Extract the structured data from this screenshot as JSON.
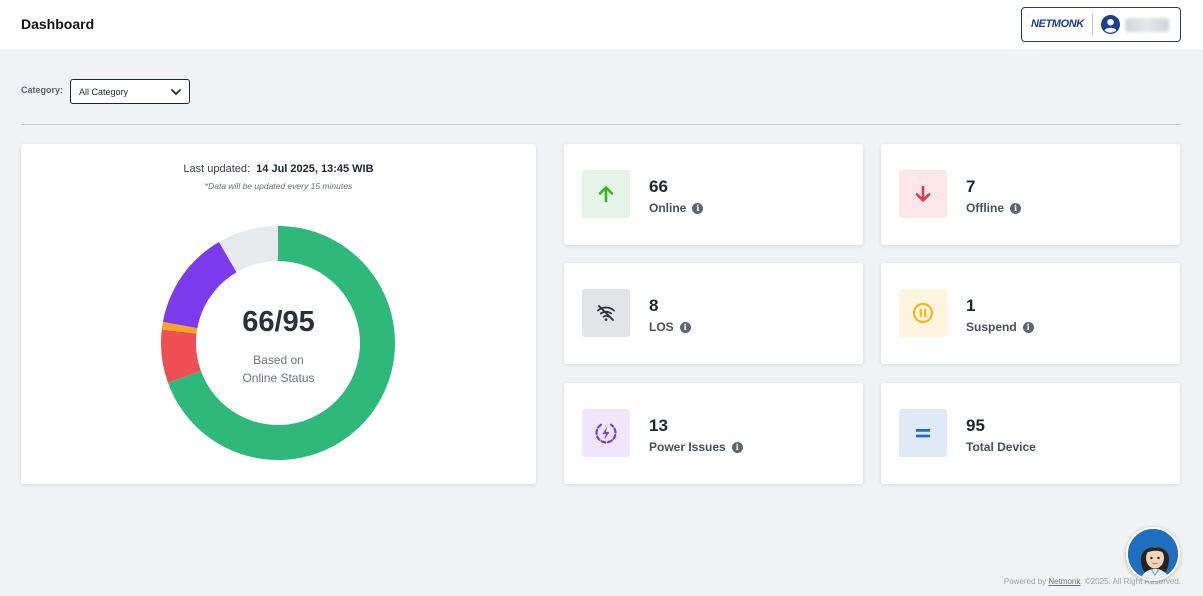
{
  "header": {
    "title": "Dashboard",
    "brand": "NETMONK",
    "user_icon": "user-circle-icon"
  },
  "filter": {
    "label": "Category:",
    "selected": "All Category",
    "icon": "chevron-down-icon"
  },
  "overview": {
    "updated_label": "Last updated:",
    "updated_value": "14 Jul 2025, 13:45 WIB",
    "update_note": "*Data will be updated every 15 minutes",
    "center_value": "66/95",
    "center_caption_line1": "Based on",
    "center_caption_line2": "Online Status"
  },
  "chart_data": {
    "type": "pie",
    "title": "",
    "categories": [
      "Online",
      "Offline",
      "Suspend",
      "Power Issues",
      "LOS"
    ],
    "values": [
      66,
      7,
      1,
      13,
      8
    ],
    "colors": [
      "#2eb87a",
      "#ee4f55",
      "#f5a623",
      "#7c3aed",
      "#e8e9eb"
    ],
    "total": 95
  },
  "stats": [
    {
      "value": "66",
      "label": "Online",
      "icon": "arrow-up-icon",
      "icon_color": "#35b81c",
      "bg": "#e5f6e8"
    },
    {
      "value": "7",
      "label": "Offline",
      "icon": "arrow-down-icon",
      "icon_color": "#e53947",
      "bg": "#fde6e8"
    },
    {
      "value": "8",
      "label": "LOS",
      "icon": "wifi-off-icon",
      "icon_color": "#2a2f3a",
      "bg": "#e3e4e7"
    },
    {
      "value": "1",
      "label": "Suspend",
      "icon": "pause-circle-icon",
      "icon_color": "#f5b71f",
      "bg": "#fff4de"
    },
    {
      "value": "13",
      "label": "Power Issues",
      "icon": "power-bolt-icon",
      "icon_color": "#7c3aed",
      "bg": "#f1e6ff"
    },
    {
      "value": "95",
      "label": "Total Device",
      "icon": "equals-icon",
      "icon_color": "#1d6fc2",
      "bg": "#dfeaf6"
    }
  ],
  "footer": {
    "prefix": "Powered by",
    "link": "Netmonk",
    "suffix": ". ©2025. All Right Reserved."
  }
}
